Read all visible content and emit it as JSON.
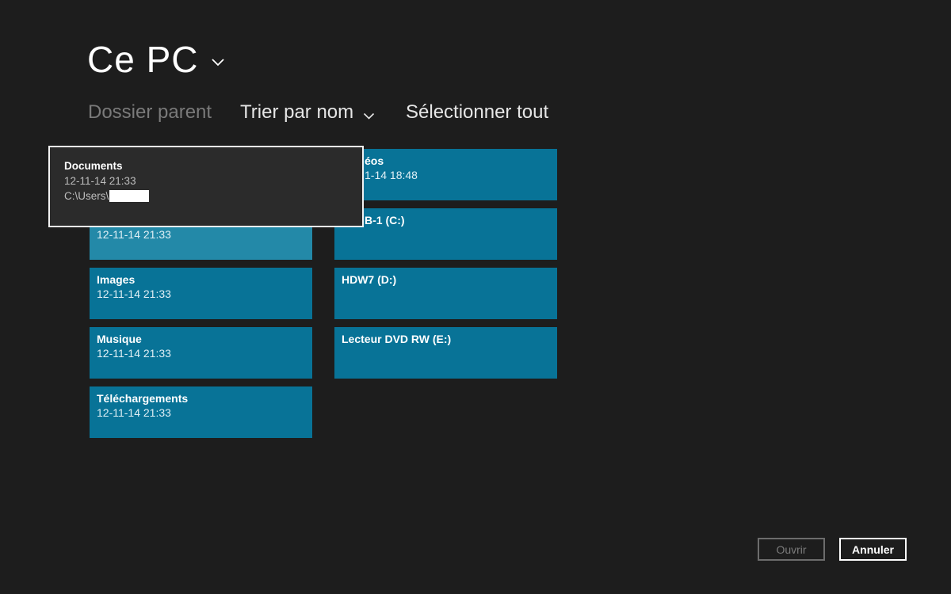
{
  "header": {
    "title": "Ce PC",
    "chevron_icon": "chevron-down-icon"
  },
  "commands": {
    "parent": "Dossier parent",
    "sort": "Trier par nom",
    "select_all": "Sélectionner tout"
  },
  "tiles": [
    {
      "name": "",
      "date": "12-11-14 21:33"
    },
    {
      "name": "Images",
      "date": "12-11-14 21:33"
    },
    {
      "name": "Musique",
      "date": "12-11-14 21:33"
    },
    {
      "name": "Téléchargements",
      "date": "12-11-14 21:33"
    },
    {
      "name": "éos",
      "date": "1-14 18:48"
    },
    {
      "name": "B-1 (C:)",
      "date": ""
    },
    {
      "name": "HDW7 (D:)",
      "date": ""
    },
    {
      "name": "Lecteur DVD RW (E:)",
      "date": ""
    }
  ],
  "tooltip": {
    "name": "Documents",
    "date": "12-11-14 21:33",
    "path": "C:\\Users\\"
  },
  "buttons": {
    "open": "Ouvrir",
    "cancel": "Annuler"
  },
  "colors": {
    "background": "#1d1d1d",
    "tile": "#087397",
    "tile_hover": "#2389a8",
    "tooltip_bg": "#2b2b2b"
  }
}
